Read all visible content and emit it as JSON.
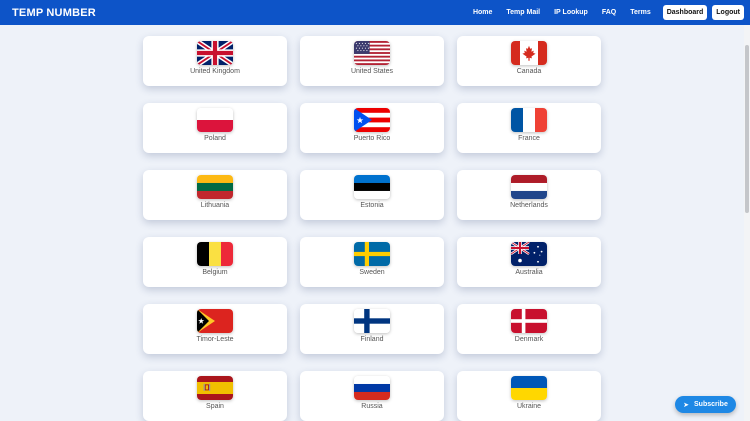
{
  "brand": "TEMP NUMBER",
  "nav": {
    "home": "Home",
    "temp_mail": "Temp Mail",
    "ip_lookup": "IP Lookup",
    "faq": "FAQ",
    "terms": "Terms",
    "dashboard": "Dashboard",
    "logout": "Logout"
  },
  "countries": [
    {
      "name": "United Kingdom",
      "flag": "uk-flag-icon"
    },
    {
      "name": "United States",
      "flag": "us-flag-icon"
    },
    {
      "name": "Canada",
      "flag": "canada-flag-icon"
    },
    {
      "name": "Poland",
      "flag": "poland-flag-icon"
    },
    {
      "name": "Puerto Rico",
      "flag": "puerto-rico-flag-icon"
    },
    {
      "name": "France",
      "flag": "france-flag-icon"
    },
    {
      "name": "Lithuania",
      "flag": "lithuania-flag-icon"
    },
    {
      "name": "Estonia",
      "flag": "estonia-flag-icon"
    },
    {
      "name": "Netherlands",
      "flag": "netherlands-flag-icon"
    },
    {
      "name": "Belgium",
      "flag": "belgium-flag-icon"
    },
    {
      "name": "Sweden",
      "flag": "sweden-flag-icon"
    },
    {
      "name": "Australia",
      "flag": "australia-flag-icon"
    },
    {
      "name": "Timor-Leste",
      "flag": "timor-leste-flag-icon"
    },
    {
      "name": "Finland",
      "flag": "finland-flag-icon"
    },
    {
      "name": "Denmark",
      "flag": "denmark-flag-icon"
    },
    {
      "name": "Spain",
      "flag": "spain-flag-icon"
    },
    {
      "name": "Russia",
      "flag": "russia-flag-icon"
    },
    {
      "name": "Ukraine",
      "flag": "ukraine-flag-icon"
    }
  ],
  "subscribe": {
    "label": "Subscribe",
    "icon": "telegram-icon"
  },
  "colors": {
    "nav_bg": "#0d54c8",
    "page_bg": "#eef2f9",
    "subscribe_bg": "#1e88e5"
  }
}
